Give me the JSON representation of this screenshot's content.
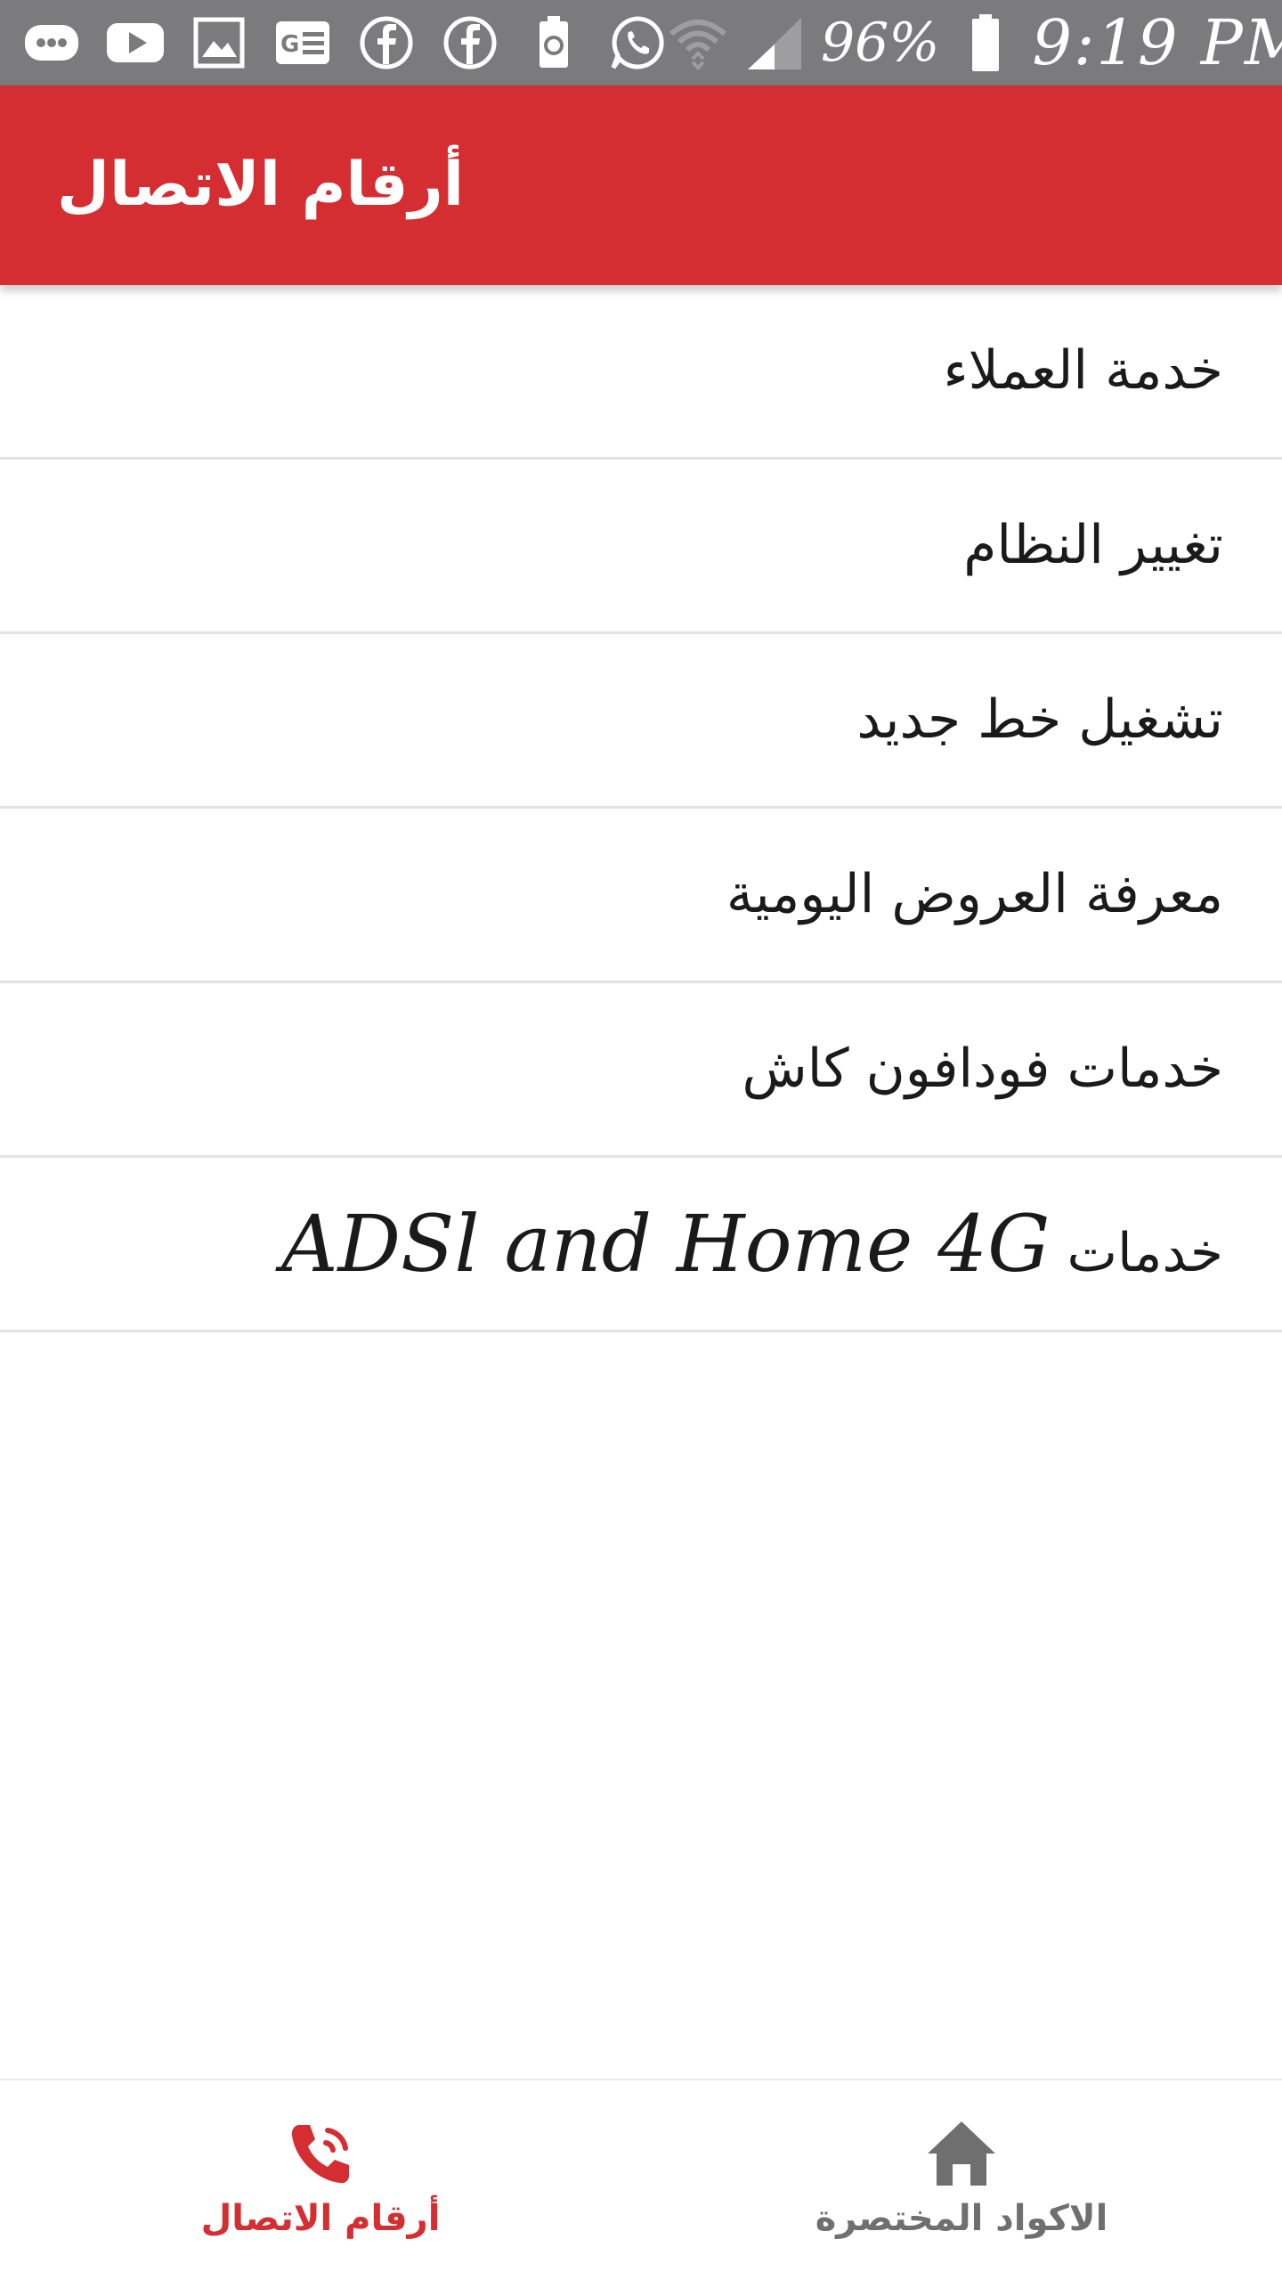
{
  "status_bar": {
    "battery_percent": "96%",
    "time": "9:19 PM",
    "icons": [
      "messenger-icon",
      "youtube-icon",
      "gallery-icon",
      "news-icon",
      "facebook-icon",
      "facebook-icon",
      "battery-saver-icon",
      "whatsapp-icon",
      "wifi-icon",
      "signal-icon",
      "battery-icon"
    ]
  },
  "app_bar": {
    "title": "أرقام الاتصال"
  },
  "menu": {
    "items": [
      {
        "label": "خدمة العملاء"
      },
      {
        "label": "تغيير النظام"
      },
      {
        "label": "تشغيل خط جديد"
      },
      {
        "label": "معرفة العروض اليومية"
      },
      {
        "label": "خدمات فودافون كاش"
      },
      {
        "label_arabic": "خدمات",
        "label_latin": "ADSl and Home 4G"
      }
    ]
  },
  "bottom_nav": {
    "items": [
      {
        "label": "أرقام الاتصال",
        "icon": "phone-call-icon",
        "active": true
      },
      {
        "label": "الاكواد المختصرة",
        "icon": "home-icon",
        "active": false
      }
    ]
  },
  "colors": {
    "status_bar": "#7b7b7d",
    "primary": "#d42d32",
    "divider": "#e3e3e3",
    "inactive": "#6f6f6f"
  }
}
